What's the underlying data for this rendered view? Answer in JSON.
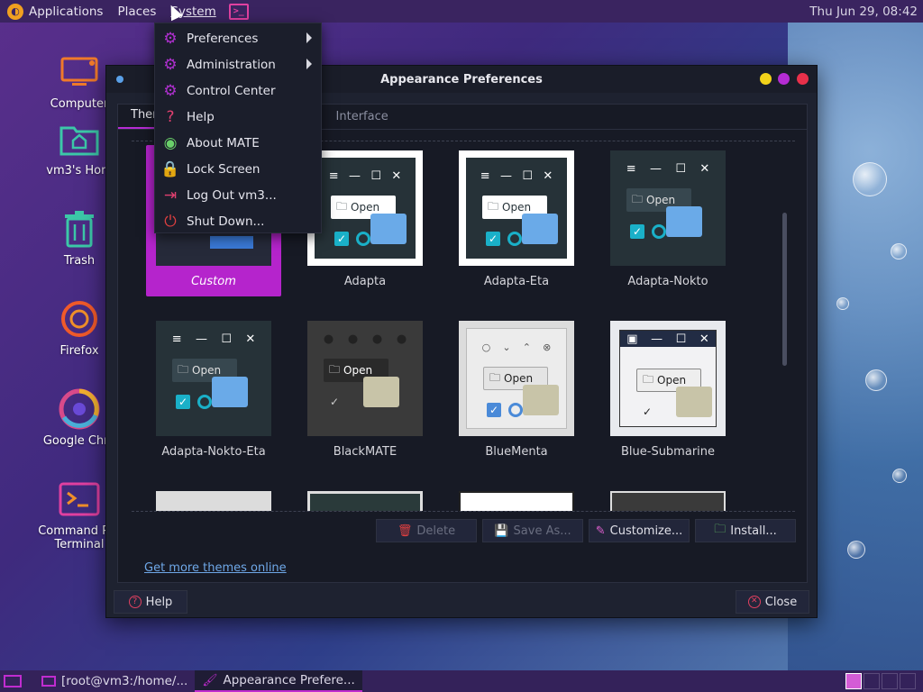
{
  "top_panel": {
    "menus": [
      "Applications",
      "Places",
      "System"
    ],
    "clock": "Thu Jun 29, 08:42"
  },
  "desktop_icons": [
    {
      "label": "Computer",
      "icon": "computer-icon"
    },
    {
      "label": "vm3's Hom",
      "icon": "home-folder-icon"
    },
    {
      "label": "Trash",
      "icon": "trash-icon"
    },
    {
      "label": "Firefox",
      "icon": "firefox-icon"
    },
    {
      "label": "Google Chro",
      "icon": "chrome-icon"
    },
    {
      "label": "Command Pro\nTerminal",
      "icon": "terminal-icon"
    }
  ],
  "system_menu": {
    "items": [
      {
        "label": "Preferences",
        "icon": "gear-icon",
        "submenu": true
      },
      {
        "label": "Administration",
        "icon": "gear-icon",
        "submenu": true
      },
      {
        "label": "Control Center",
        "icon": "gear-icon",
        "submenu": false
      },
      {
        "label": "Help",
        "icon": "help-icon",
        "submenu": false
      },
      {
        "label": "About MATE",
        "icon": "mate-logo-icon",
        "submenu": false
      },
      {
        "label": "Lock Screen",
        "icon": "lock-icon",
        "submenu": false
      },
      {
        "label": "Log Out vm3...",
        "icon": "logout-icon",
        "submenu": false
      },
      {
        "label": "Shut Down...",
        "icon": "power-icon",
        "submenu": false
      }
    ]
  },
  "window": {
    "title": "Appearance Preferences",
    "tabs": [
      "Ther",
      "Interface"
    ],
    "themes": [
      {
        "label": "Custom",
        "selected": true
      },
      {
        "label": "Adapta"
      },
      {
        "label": "Adapta-Eta"
      },
      {
        "label": "Adapta-Nokto"
      },
      {
        "label": "Adapta-Nokto-Eta"
      },
      {
        "label": "BlackMATE"
      },
      {
        "label": "BlueMenta"
      },
      {
        "label": "Blue-Submarine"
      }
    ],
    "thumb_open_label": "Open",
    "buttons": {
      "delete": "Delete",
      "save_as": "Save As...",
      "customize": "Customize...",
      "install": "Install..."
    },
    "more_themes_link": "Get more themes online",
    "help": "Help",
    "close": "Close"
  },
  "bottom_panel": {
    "tasks": [
      "[root@vm3:/home/...",
      "Appearance Prefere..."
    ]
  },
  "colors": {
    "accent": "#b524cc",
    "panel": "#3a2460",
    "window_bg": "#1e2230"
  }
}
